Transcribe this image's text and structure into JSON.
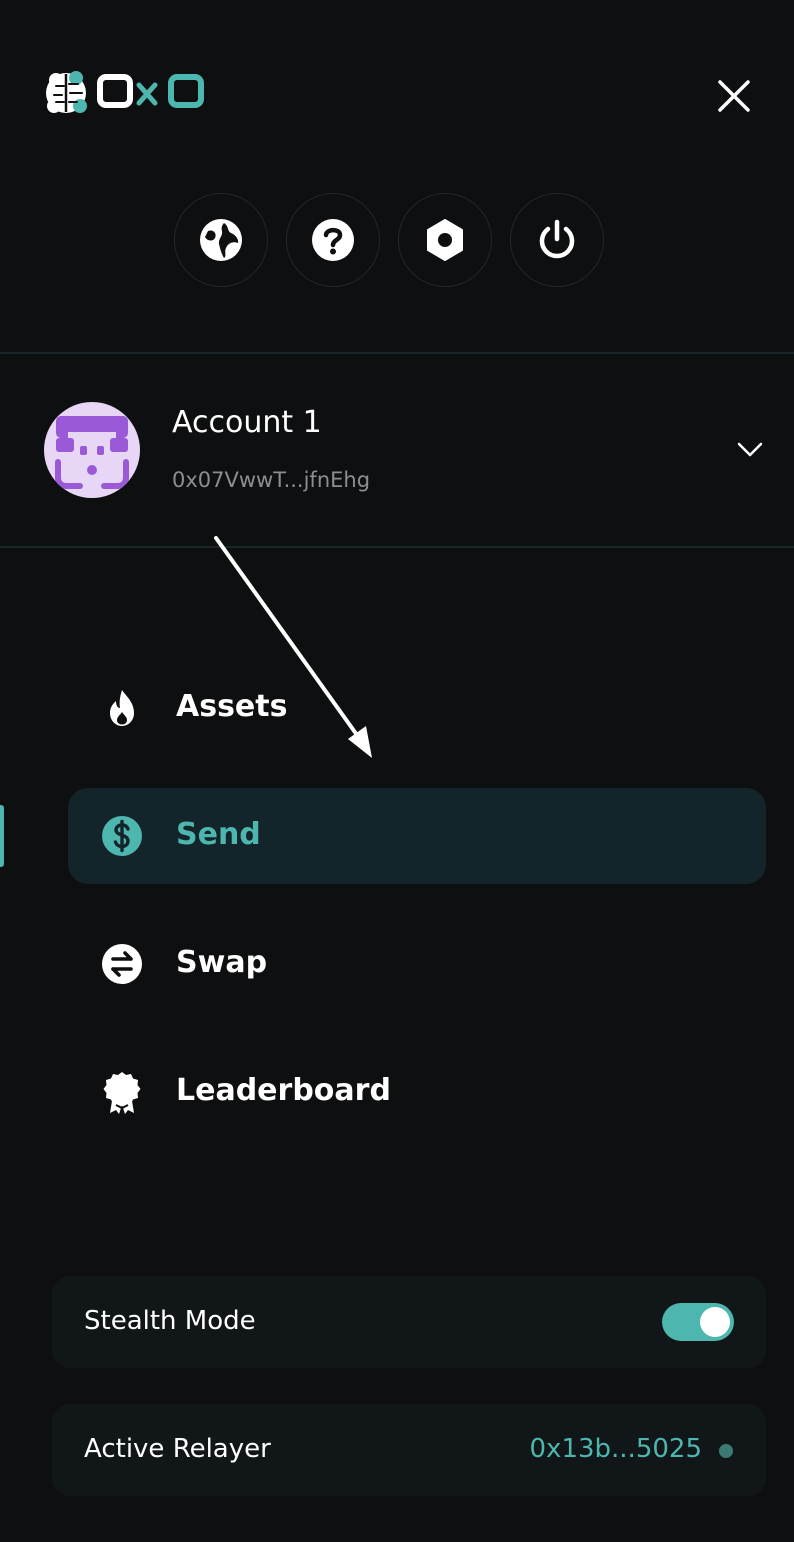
{
  "header": {
    "logo_text": "OxO",
    "close_icon": "close-icon"
  },
  "quick_actions": [
    {
      "name": "globe-icon"
    },
    {
      "name": "help-icon"
    },
    {
      "name": "settings-icon"
    },
    {
      "name": "power-icon"
    }
  ],
  "account": {
    "name": "Account 1",
    "address": "0x07VwwT...jfnEhg",
    "avatar_icon": "avatar-face-icon",
    "toggle_icon": "chevron-down-icon"
  },
  "nav": {
    "items": [
      {
        "label": "Assets",
        "icon": "flame-icon",
        "active": false
      },
      {
        "label": "Send",
        "icon": "dollar-icon",
        "active": true
      },
      {
        "label": "Swap",
        "icon": "swap-arrows-icon",
        "active": false
      },
      {
        "label": "Leaderboard",
        "icon": "award-badge-icon",
        "active": false
      }
    ]
  },
  "settings": {
    "stealth_mode_label": "Stealth Mode",
    "stealth_mode_on": true,
    "active_relayer_label": "Active Relayer",
    "active_relayer_value": "0x13b...5025"
  },
  "colors": {
    "accent": "#4db6ae",
    "background": "#0e0f10",
    "active_bg": "#13252a",
    "avatar_bg": "#e7d6f5",
    "avatar_fg": "#9a5ad8"
  }
}
